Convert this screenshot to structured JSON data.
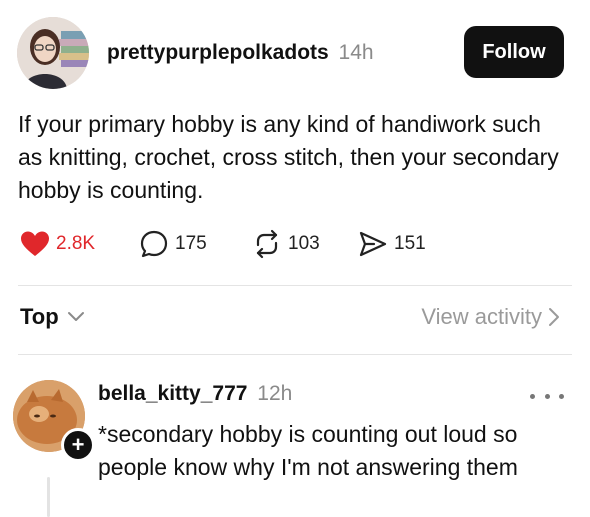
{
  "post": {
    "username": "prettypurplepolkadots",
    "timestamp": "14h",
    "follow_label": "Follow",
    "body": "If your primary hobby is any kind of handiwork such as knitting, crochet, cross stitch, then your secondary hobby is counting.",
    "actions": {
      "likes": "2.8K",
      "replies": "175",
      "reposts": "103",
      "shares": "151"
    },
    "like_color": "#e0272b"
  },
  "sort": {
    "label": "Top",
    "view_activity": "View activity"
  },
  "reply": {
    "username": "bella_kitty_777",
    "timestamp": "12h",
    "body": "*secondary hobby is counting out loud so people know why I'm not answering them",
    "badge": "+"
  },
  "icons": {
    "like": "heart-filled-icon",
    "reply": "speech-bubble-icon",
    "repost": "repost-arrows-icon",
    "share": "send-icon",
    "sort": "chevron-down-icon",
    "view_activity": "chevron-right-icon",
    "more": "more-dots-icon"
  }
}
